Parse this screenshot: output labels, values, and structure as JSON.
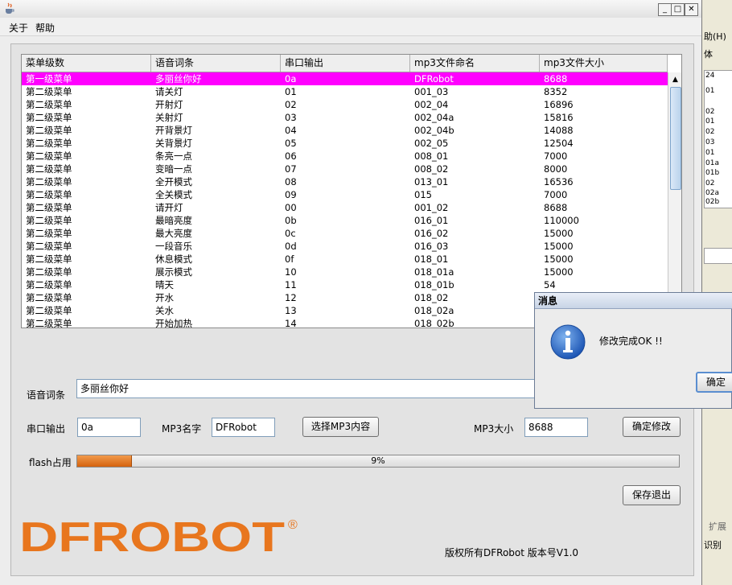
{
  "background_window": {
    "menu_text": "助(H)",
    "font_text": "体",
    "list_values": [
      "24",
      "01",
      "02",
      "01",
      "02",
      "03",
      "01",
      "01a",
      "01b",
      "02",
      "02a",
      "02b"
    ],
    "tab_label": "扩展",
    "recognize_label": "识别"
  },
  "menubar": {
    "about": "关于",
    "help": "帮助"
  },
  "table": {
    "columns": [
      "菜单级数",
      "语音词条",
      "串口输出",
      "mp3文件命名",
      "mp3文件大小"
    ],
    "rows": [
      [
        "第一级菜单",
        "多丽丝你好",
        "0a",
        "DFRobot",
        "8688"
      ],
      [
        "第二级菜单",
        "请关灯",
        "01",
        "001_03",
        "8352"
      ],
      [
        "第二级菜单",
        "开射灯",
        "02",
        "002_04",
        "16896"
      ],
      [
        "第二级菜单",
        "关射灯",
        "03",
        "002_04a",
        "15816"
      ],
      [
        "第二级菜单",
        "开背景灯",
        "04",
        "002_04b",
        "14088"
      ],
      [
        "第二级菜单",
        "关背景灯",
        "05",
        "002_05",
        "12504"
      ],
      [
        "第二级菜单",
        "条亮一点",
        "06",
        "008_01",
        "7000"
      ],
      [
        "第二级菜单",
        "变暗一点",
        "07",
        "008_02",
        "8000"
      ],
      [
        "第二级菜单",
        "全开模式",
        "08",
        "013_01",
        "16536"
      ],
      [
        "第二级菜单",
        "全关模式",
        "09",
        "015",
        "7000"
      ],
      [
        "第二级菜单",
        "请开灯",
        "00",
        "001_02",
        "8688"
      ],
      [
        "第二级菜单",
        "最暗亮度",
        "0b",
        "016_01",
        "110000"
      ],
      [
        "第二级菜单",
        "最大亮度",
        "0c",
        "016_02",
        "15000"
      ],
      [
        "第二级菜单",
        "一段音乐",
        "0d",
        "016_03",
        "15000"
      ],
      [
        "第二级菜单",
        "休息模式",
        "0f",
        "018_01",
        "15000"
      ],
      [
        "第二级菜单",
        "展示模式",
        "10",
        "018_01a",
        "15000"
      ],
      [
        "第二级菜单",
        "晴天",
        "11",
        "018_01b",
        "54"
      ],
      [
        "第二级菜单",
        "开水",
        "12",
        "018_02",
        ""
      ],
      [
        "第二级菜单",
        "关水",
        "13",
        "018_02a",
        ""
      ],
      [
        "第二级菜单",
        "开始加热",
        "14",
        "018_02b",
        ""
      ]
    ],
    "selected_color": "#ff00ff"
  },
  "form": {
    "voice_label": "语音词条",
    "voice_value": "多丽丝你好",
    "serial_label": "串口输出",
    "serial_value": "0a",
    "mp3name_label": "MP3名字",
    "mp3name_value": "DFRobot",
    "select_mp3_button": "选择MP3内容",
    "mp3size_label": "MP3大小",
    "mp3size_value": "8688",
    "confirm_button": "确定修改",
    "flash_label": "flash占用",
    "flash_percent_text": "9%",
    "flash_fraction": 0.09,
    "save_exit_button": "保存退出"
  },
  "footer": {
    "logo_text": "DFROBOT",
    "registered_mark": "®",
    "logo_color": "#e8761e",
    "copyright": "版权所有DFRobot 版本号V1.0"
  },
  "dialog": {
    "title": "消息",
    "message": "修改完成OK !!",
    "ok_button": "确定",
    "icon": "info-icon"
  }
}
